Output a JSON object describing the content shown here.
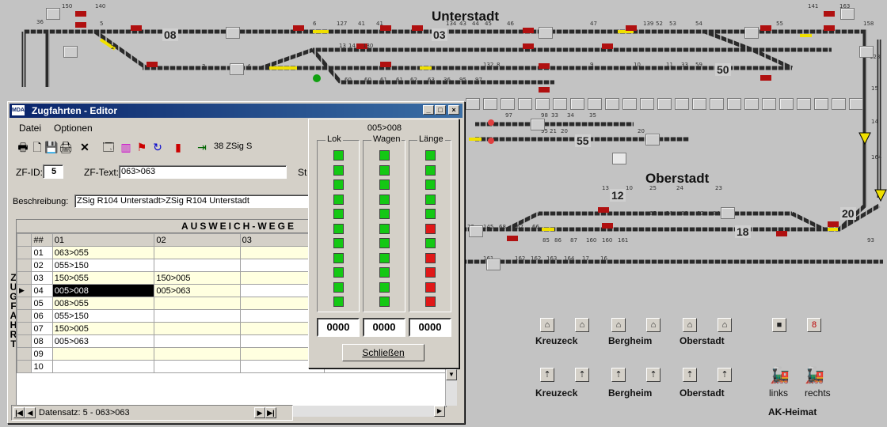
{
  "layout": {
    "stations": {
      "unterstadt": "Unterstadt",
      "oberstadt": "Oberstadt"
    },
    "segment_numbers": [
      "08",
      "03",
      "50",
      "55",
      "12",
      "18",
      "20"
    ],
    "small_numbers": [
      "150",
      "140",
      "36",
      "2",
      "3",
      "4",
      "5",
      "6",
      "127",
      "41",
      "41",
      "134",
      "43",
      "44",
      "45",
      "46",
      "47",
      "139",
      "52",
      "53",
      "54",
      "55",
      "141",
      "163",
      "158",
      "13",
      "128",
      "14",
      "130",
      "132",
      "8",
      "9",
      "10",
      "11",
      "33",
      "59",
      "60",
      "60",
      "61",
      "61",
      "62",
      "63",
      "36",
      "95",
      "97",
      "97",
      "98",
      "33",
      "34",
      "35",
      "95",
      "21",
      "20",
      "20",
      "13",
      "10",
      "25",
      "24",
      "23",
      "22",
      "145",
      "68",
      "67",
      "66",
      "65",
      "64",
      "82",
      "83",
      "84",
      "85",
      "86",
      "87",
      "160",
      "160",
      "161",
      "161",
      "162",
      "162",
      "163",
      "164",
      "17",
      "16",
      "15",
      "14",
      "164",
      "93"
    ]
  },
  "panel": {
    "row1": [
      "Kreuzeck",
      "Bergheim",
      "Oberstadt"
    ],
    "row2": [
      "Kreuzeck",
      "Bergheim",
      "Oberstadt"
    ],
    "extra_labels": [
      "links",
      "rechts"
    ],
    "footer": "AK-Heimat",
    "icons": [
      "house-up-icon",
      "house-down-icon",
      "locomotive-icon"
    ]
  },
  "editor": {
    "title": "Zugfahrten - Editor",
    "menu": [
      "Datei",
      "Optionen"
    ],
    "toolbar_text": "38 ZSig S",
    "zf_id_label": "ZF-ID:",
    "zf_id_value": "5",
    "zf_text_label": "ZF-Text:",
    "zf_text_value": "063>063",
    "st_label": "St",
    "beschreibung_label": "Beschreibung:",
    "beschreibung_value": "ZSig R104 Unterstadt>ZSig R104 Unterstadt",
    "grid_title": "AUSWEICH-WEGE",
    "grid_columns": [
      "##",
      "01",
      "02",
      "03"
    ],
    "grid_rows": [
      {
        "n": "01",
        "c1": "063>055",
        "c2": ""
      },
      {
        "n": "02",
        "c1": "055>150",
        "c2": ""
      },
      {
        "n": "03",
        "c1": "150>055",
        "c2": "150>005"
      },
      {
        "n": "04",
        "c1": "005>008",
        "c2": "005>063"
      },
      {
        "n": "05",
        "c1": "008>055",
        "c2": ""
      },
      {
        "n": "06",
        "c1": "055>150",
        "c2": ""
      },
      {
        "n": "07",
        "c1": "150>005",
        "c2": ""
      },
      {
        "n": "08",
        "c1": "005>063",
        "c2": ""
      },
      {
        "n": "09",
        "c1": "",
        "c2": ""
      },
      {
        "n": "10",
        "c1": "",
        "c2": ""
      }
    ],
    "side_letters": "ZUGFAHRT",
    "statusbar": "Datensatz: 5 - 063>063"
  },
  "lok_panel": {
    "header": "005>008",
    "groups": [
      {
        "label": "Lok",
        "states": [
          "g",
          "g",
          "g",
          "g",
          "g",
          "g",
          "g",
          "g",
          "g",
          "g",
          "g"
        ],
        "counter": "0000"
      },
      {
        "label": "Wagen",
        "states": [
          "g",
          "g",
          "g",
          "g",
          "g",
          "g",
          "g",
          "g",
          "g",
          "g",
          "g"
        ],
        "counter": "0000"
      },
      {
        "label": "Länge",
        "states": [
          "g",
          "g",
          "g",
          "g",
          "g",
          "r",
          "g",
          "r",
          "r",
          "r",
          "r"
        ],
        "counter": "0000"
      }
    ],
    "close_label": "Schließen"
  },
  "colors": {
    "indicator_on": "#14c814",
    "indicator_alert": "#e01818",
    "track": "#2a2a2a",
    "track_highlight": "#f0e000",
    "title_bar": "#0a246a"
  }
}
